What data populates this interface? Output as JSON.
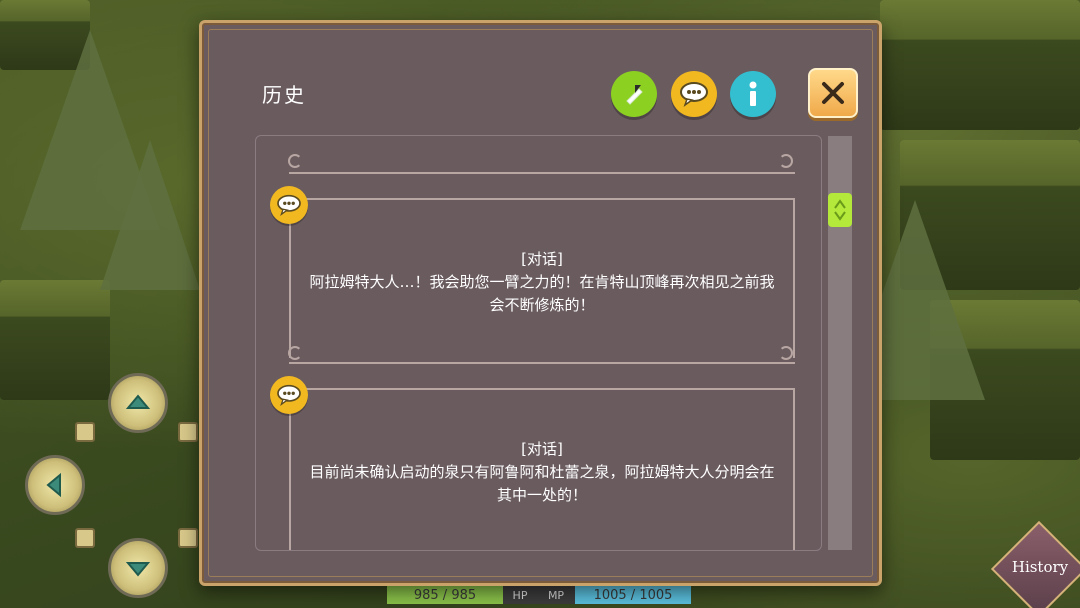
{
  "panel": {
    "title": "历史",
    "close_icon": "close-icon",
    "header_buttons": [
      {
        "name": "log-button",
        "icon": "quill-icon",
        "color": "#8cd022"
      },
      {
        "name": "dialogue-filter-button",
        "icon": "speech-bubble-icon",
        "color": "#f1b820"
      },
      {
        "name": "info-button",
        "icon": "info-icon",
        "color": "#33bfd0"
      }
    ]
  },
  "entries": [
    {
      "type_label": "[对话]",
      "text_line1": "阿拉姆特大人…！我会助您一臂之力的！在肯特山顶峰再次相见之前我",
      "text_line2": "会不断修炼的！",
      "icon": "speech-bubble-icon"
    },
    {
      "type_label": "[对话]",
      "text_line1": "目前尚未确认启动的泉只有阿鲁阿和杜蕾之泉，阿拉姆特大人分明会在",
      "text_line2": "其中一处的！",
      "icon": "speech-bubble-icon"
    }
  ],
  "hud": {
    "hp_value": "985 / 985",
    "hp_label": "HP",
    "mp_label": "MP",
    "mp_value": "1005 / 1005",
    "hp_color": "#8bc34a",
    "mp_color": "#5bc0de"
  },
  "history_button": {
    "label": "History"
  },
  "colors": {
    "panel_bg": "#6a5b5f",
    "panel_border": "#c9a36a",
    "scroll_thumb": "#b4e83a"
  }
}
